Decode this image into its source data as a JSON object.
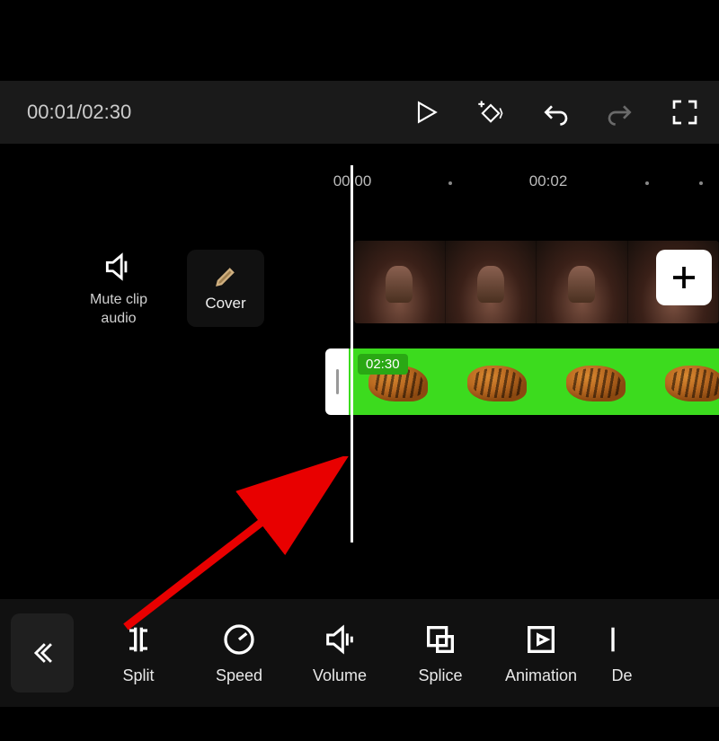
{
  "playback": {
    "current_time": "00:01",
    "total_time": "02:30"
  },
  "ruler": {
    "labels": [
      "00:00",
      "00:02"
    ],
    "positions": [
      392,
      610
    ],
    "dots": [
      501,
      720,
      780
    ]
  },
  "left_panel": {
    "mute_label_line1": "Mute clip",
    "mute_label_line2": "audio",
    "cover_label": "Cover"
  },
  "tracks": {
    "overlay_duration": "02:30"
  },
  "toolbar": {
    "items": [
      {
        "name": "split",
        "label": "Split",
        "icon": "split-icon"
      },
      {
        "name": "speed",
        "label": "Speed",
        "icon": "speed-icon"
      },
      {
        "name": "volume",
        "label": "Volume",
        "icon": "volume-icon"
      },
      {
        "name": "splice",
        "label": "Splice",
        "icon": "splice-icon"
      },
      {
        "name": "animation",
        "label": "Animation",
        "icon": "animation-icon"
      },
      {
        "name": "delete",
        "label": "De",
        "icon": "delete-icon"
      }
    ]
  },
  "colors": {
    "accent_green": "#3cdb1e",
    "arrow_red": "#e80000"
  }
}
